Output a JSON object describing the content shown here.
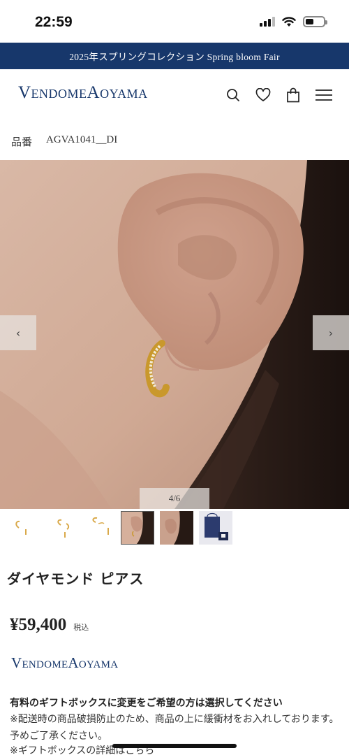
{
  "status_bar": {
    "time": "22:59",
    "battery_level": 0.45,
    "icons": [
      "signal-icon",
      "wifi-icon",
      "battery-icon"
    ]
  },
  "banner": {
    "text": "2025年スプリングコレクション Spring bloom Fair",
    "background": "#17376b"
  },
  "header": {
    "logo": "VendomeAoyama",
    "icons": [
      "search-icon",
      "heart-icon",
      "bag-icon",
      "menu-icon"
    ],
    "brand_color": "#17376b"
  },
  "product": {
    "number_label": "品番",
    "number_value": "AGVA1041__DI",
    "name": "ダイヤモンド ピアス",
    "price": "¥59,400",
    "tax_label": "税込",
    "brand": "VendomeAoyama"
  },
  "gallery": {
    "counter": "4/6",
    "prev_label": "‹",
    "next_label": "›",
    "active_index": 4
  },
  "gift": {
    "title": "有料のギフトボックスに変更をご希望の方は選択してください",
    "note": "※配送時の商品破損防止のため、商品の上に緩衝材をお入れしております。予めご了承ください。",
    "link": "※ギフトボックスの詳細はこちら"
  }
}
